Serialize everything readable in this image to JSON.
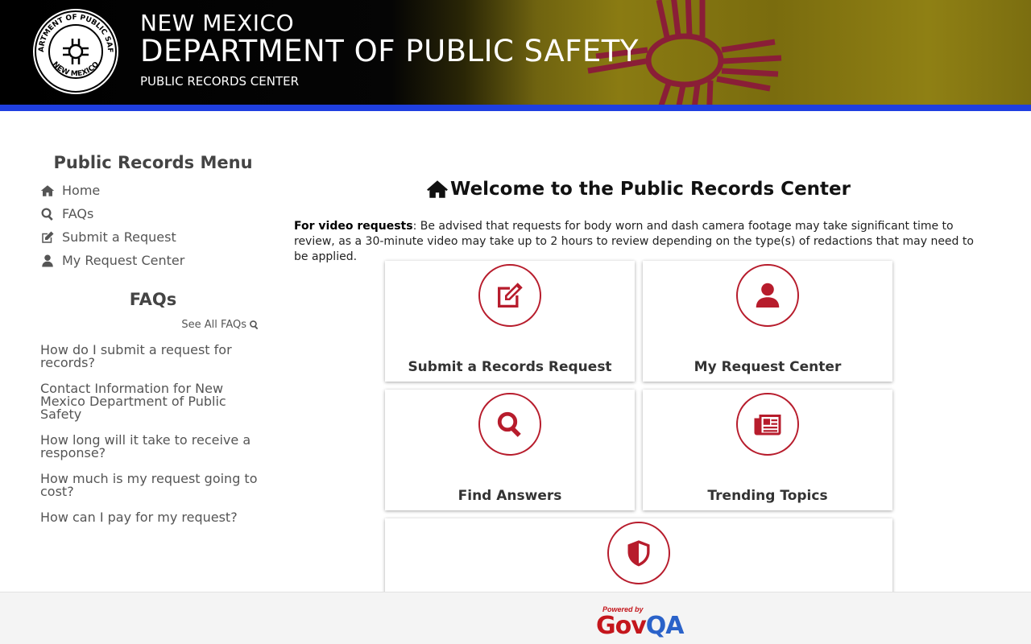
{
  "header": {
    "state": "NEW MEXICO",
    "department": "DEPARTMENT OF PUBLIC SAFETY",
    "subtitle": "PUBLIC RECORDS CENTER",
    "seal_text_top": "DEPARTMENT OF PUBLIC SAFETY",
    "seal_text_bottom": "NEW MEXICO"
  },
  "sidebar": {
    "menu_title": "Public Records Menu",
    "items": [
      {
        "label": "Home",
        "icon": "home-icon"
      },
      {
        "label": "FAQs",
        "icon": "search-icon"
      },
      {
        "label": "Submit a Request",
        "icon": "edit-icon"
      },
      {
        "label": "My Request Center",
        "icon": "user-icon"
      }
    ],
    "faq_title": "FAQs",
    "see_all": "See All FAQs",
    "faqs": [
      "How do I submit a request for records?",
      "Contact Information for New Mexico Department of Public Safety",
      "How long will it take to receive a response?",
      "How much is my request going to cost?",
      "How can I pay for my request?"
    ]
  },
  "main": {
    "title": "Welcome to the Public Records Center",
    "notice_bold": "For video requests",
    "notice_text": ": Be advised that requests for body worn and dash camera footage may take significant time to review, as a 30-minute video may take up to 2 hours to review depending on the type(s) of redactions that may need to be applied.",
    "cards": [
      {
        "label": "Submit a Records Request",
        "icon": "edit-icon"
      },
      {
        "label": "My Request Center",
        "icon": "user-icon"
      },
      {
        "label": "Find Answers",
        "icon": "search-icon"
      },
      {
        "label": "Trending Topics",
        "icon": "newspaper-icon"
      },
      {
        "label": "",
        "icon": "shield-icon"
      }
    ]
  },
  "footer": {
    "powered_by": "Powered by",
    "brand_gov": "Gov",
    "brand_qa": "QA"
  },
  "colors": {
    "accent": "#b71c2c",
    "header_bar": "#1f3fe0",
    "zia": "#8b1a3a"
  }
}
